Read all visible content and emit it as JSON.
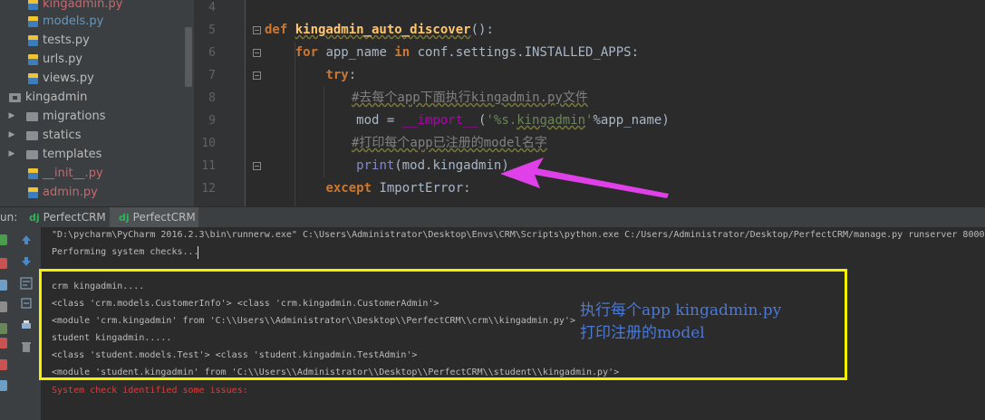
{
  "project_tree": {
    "items": [
      {
        "label": "kingadmin.py",
        "kind": "file-red"
      },
      {
        "label": "models.py",
        "kind": "file-mod"
      },
      {
        "label": "tests.py",
        "kind": "file"
      },
      {
        "label": "urls.py",
        "kind": "file"
      },
      {
        "label": "views.py",
        "kind": "file"
      },
      {
        "label": "kingadmin",
        "kind": "package"
      },
      {
        "label": "migrations",
        "kind": "folder"
      },
      {
        "label": "statics",
        "kind": "folder"
      },
      {
        "label": "templates",
        "kind": "folder"
      },
      {
        "label": "__init__.py",
        "kind": "file-red"
      },
      {
        "label": "admin.py",
        "kind": "file-red"
      }
    ]
  },
  "editor": {
    "line_numbers": [
      "4",
      "5",
      "6",
      "7",
      "8",
      "9",
      "10",
      "11",
      "12"
    ],
    "lines": [
      "",
      "def kingadmin_auto_discover():",
      "    for app_name in conf.settings.INSTALLED_APPS:",
      "        try:",
      "            #去每个app下面执行kingadmin.py文件",
      "            mod = __import__('%s.kingadmin'%app_name)",
      "            #打印每个app已注册的model名字",
      "            print(mod.kingadmin)",
      "        except ImportError:"
    ]
  },
  "run_panel": {
    "label": "un:",
    "tabs": [
      "PerfectCRM",
      "PerfectCRM"
    ],
    "active_tab": 1
  },
  "console": {
    "command": "\"D:\\pycharm\\PyCharm 2016.2.3\\bin\\runnerw.exe\" C:\\Users\\Administrator\\Desktop\\Envs\\CRM\\Scripts\\python.exe C:/Users/Administrator/Desktop/PerfectCRM/manage.py runserver 8000",
    "checks": "Performing system checks...",
    "output": [
      "crm kingadmin....",
      "<class 'crm.models.CustomerInfo'> <class 'crm.kingadmin.CustomerAdmin'>",
      "<module 'crm.kingadmin' from 'C:\\\\Users\\\\Administrator\\\\Desktop\\\\PerfectCRM\\\\crm\\\\kingadmin.py'>",
      "student kingadmin.....",
      "<class 'student.models.Test'> <class 'student.kingadmin.TestAdmin'>",
      "<module 'student.kingadmin' from 'C:\\\\Users\\\\Administrator\\\\Desktop\\\\PerfectCRM\\\\student\\\\kingadmin.py'>"
    ],
    "error": "System check identified some issues:"
  },
  "annotation": {
    "line1": "执行每个app kingadmin.py",
    "line2": "打印注册的model",
    "box_color": "#f5f200",
    "arrow_color": "#e040e8",
    "text_color": "#4a79d6"
  },
  "toolbar_icons": [
    "rerun-icon",
    "stop-icon",
    "pause-icon",
    "restore-layout-icon",
    "pin-icon",
    "print-icon",
    "clear-icon",
    "close-icon",
    "help-icon",
    "arrow-up-icon",
    "arrow-down-icon",
    "soft-wrap-icon",
    "scroll-to-end-icon",
    "print-output-icon",
    "trash-icon"
  ]
}
